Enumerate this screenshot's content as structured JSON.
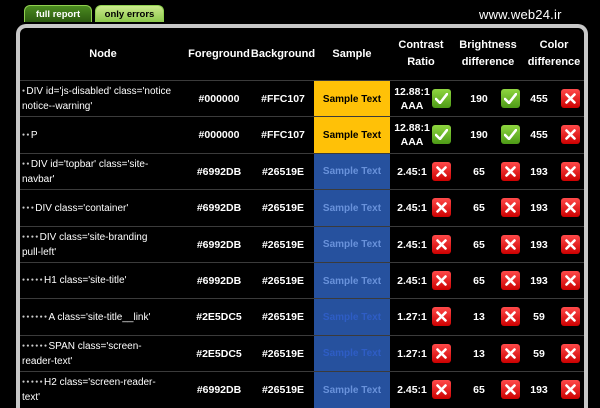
{
  "tabs": [
    {
      "label": "full report"
    },
    {
      "label": "only errors"
    }
  ],
  "watermark": "www.web24.ir",
  "columns": [
    "Node",
    "Foreground",
    "Background",
    "Sample",
    "Contrast\nRatio",
    "Brightness\ndifference",
    "Color\ndifference"
  ],
  "rows": [
    {
      "indent": "● ",
      "node": [
        "DIV id='js-disabled' class='notice",
        "notice--warning'"
      ],
      "fg": "#000000",
      "bg": "#FFC107",
      "sample": "Sample Text",
      "sample_bg": "#FFC107",
      "sample_fg": "#000000",
      "ratio": "12.88:1",
      "ratio2": "AAA",
      "ratio_pass": true,
      "brightness": "190",
      "bright_pass": true,
      "color": "455",
      "color_pass": false
    },
    {
      "indent": "● ● ",
      "node": [
        "P"
      ],
      "fg": "#000000",
      "bg": "#FFC107",
      "sample": "Sample Text",
      "sample_bg": "#FFC107",
      "sample_fg": "#000000",
      "ratio": "12.88:1",
      "ratio2": "AAA",
      "ratio_pass": true,
      "brightness": "190",
      "bright_pass": true,
      "color": "455",
      "color_pass": false
    },
    {
      "indent": "● ● ",
      "node": [
        "DIV id='topbar' class='site-",
        "navbar'"
      ],
      "fg": "#6992DB",
      "bg": "#26519E",
      "sample": "Sample Text",
      "sample_bg": "#26519E",
      "sample_fg": "#6992DB",
      "ratio": "2.45:1",
      "ratio2": "",
      "ratio_pass": false,
      "brightness": "65",
      "bright_pass": false,
      "color": "193",
      "color_pass": false
    },
    {
      "indent": "● ● ● ",
      "node": [
        "DIV class='container'"
      ],
      "fg": "#6992DB",
      "bg": "#26519E",
      "sample": "Sample Text",
      "sample_bg": "#26519E",
      "sample_fg": "#6992DB",
      "ratio": "2.45:1",
      "ratio2": "",
      "ratio_pass": false,
      "brightness": "65",
      "bright_pass": false,
      "color": "193",
      "color_pass": false
    },
    {
      "indent": "● ● ● ● ",
      "node": [
        "DIV class='site-branding",
        "pull-left'"
      ],
      "fg": "#6992DB",
      "bg": "#26519E",
      "sample": "Sample Text",
      "sample_bg": "#26519E",
      "sample_fg": "#6992DB",
      "ratio": "2.45:1",
      "ratio2": "",
      "ratio_pass": false,
      "brightness": "65",
      "bright_pass": false,
      "color": "193",
      "color_pass": false
    },
    {
      "indent": "● ● ● ● ● ",
      "node": [
        "H1 class='site-title'"
      ],
      "fg": "#6992DB",
      "bg": "#26519E",
      "sample": "Sample Text",
      "sample_bg": "#26519E",
      "sample_fg": "#6992DB",
      "ratio": "2.45:1",
      "ratio2": "",
      "ratio_pass": false,
      "brightness": "65",
      "bright_pass": false,
      "color": "193",
      "color_pass": false
    },
    {
      "indent": "● ● ● ● ● ● ",
      "node": [
        "A class='site-title__link'"
      ],
      "fg": "#2E5DC5",
      "bg": "#26519E",
      "sample": "Sample Text",
      "sample_bg": "#26519E",
      "sample_fg": "#2E5DC5",
      "ratio": "1.27:1",
      "ratio2": "",
      "ratio_pass": false,
      "brightness": "13",
      "bright_pass": false,
      "color": "59",
      "color_pass": false
    },
    {
      "indent": "● ● ● ● ● ● ",
      "node": [
        "SPAN class='screen-",
        "reader-text'"
      ],
      "fg": "#2E5DC5",
      "bg": "#26519E",
      "sample": "Sample Text",
      "sample_bg": "#26519E",
      "sample_fg": "#2E5DC5",
      "ratio": "1.27:1",
      "ratio2": "",
      "ratio_pass": false,
      "brightness": "13",
      "bright_pass": false,
      "color": "59",
      "color_pass": false
    },
    {
      "indent": "● ● ● ● ● ",
      "node": [
        "H2 class='screen-reader-",
        "text'"
      ],
      "fg": "#6992DB",
      "bg": "#26519E",
      "sample": "Sample Text",
      "sample_bg": "#26519E",
      "sample_fg": "#6992DB",
      "ratio": "2.45:1",
      "ratio2": "",
      "ratio_pass": false,
      "brightness": "65",
      "bright_pass": false,
      "color": "193",
      "color_pass": false
    }
  ]
}
